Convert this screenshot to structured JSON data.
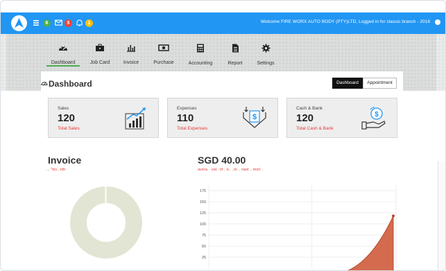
{
  "topbar": {
    "messages_badge": "6",
    "mail_badge": "5",
    "alerts_badge": "1",
    "welcome_text": "Welcome FIRE WORX AUTO BODY (PTY)LTD, Logged in for classic branch - 2018",
    "colors": {
      "bar": "#2196f3",
      "badge_green": "#4caf50",
      "badge_red": "#f44336",
      "badge_yellow": "#ffc107"
    }
  },
  "nav": {
    "items": [
      {
        "label": "Dashboard",
        "icon": "speedometer-icon"
      },
      {
        "label": "Job Card",
        "icon": "briefcase-icon"
      },
      {
        "label": "Invoice",
        "icon": "bar-chart-icon"
      },
      {
        "label": "Purchase",
        "icon": "cash-icon"
      },
      {
        "label": "Accounting",
        "icon": "calculator-icon"
      },
      {
        "label": "Report",
        "icon": "document-icon"
      },
      {
        "label": "Settings",
        "icon": "gear-icon"
      }
    ],
    "active": "Dashboard"
  },
  "header": {
    "title": "Dashboard",
    "toggle": {
      "dashboard": "Dashboard",
      "appointment": "Appointment"
    }
  },
  "cards": [
    {
      "label": "Sales",
      "value": "120",
      "sub": "Total Sales",
      "icon": "growth-chart-icon"
    },
    {
      "label": "Expenses",
      "value": "110",
      "sub": "Total Expenses",
      "icon": "dollar-down-icon"
    },
    {
      "label": "Cash & Bank",
      "value": "120",
      "sub": "Total Cash & Bank",
      "icon": "cash-hand-icon"
    }
  ],
  "invoice": {
    "title": "Invoice",
    "subtitle": "... \"his ..nth"
  },
  "amount": {
    "title": "SGD 40.00",
    "subtitle": "avera.. .val.. of ..'e.. ..tn .. nast .. mon'.."
  },
  "chart_data": {
    "type": "area",
    "yticks": [
      25,
      50,
      75,
      100,
      125,
      150,
      175
    ],
    "series": [
      {
        "values": [
          0,
          0,
          0,
          0,
          10,
          35,
          70,
          118
        ]
      }
    ],
    "fill": "#d46b4f"
  },
  "donut_data": {
    "color": "#e2e5d3"
  }
}
